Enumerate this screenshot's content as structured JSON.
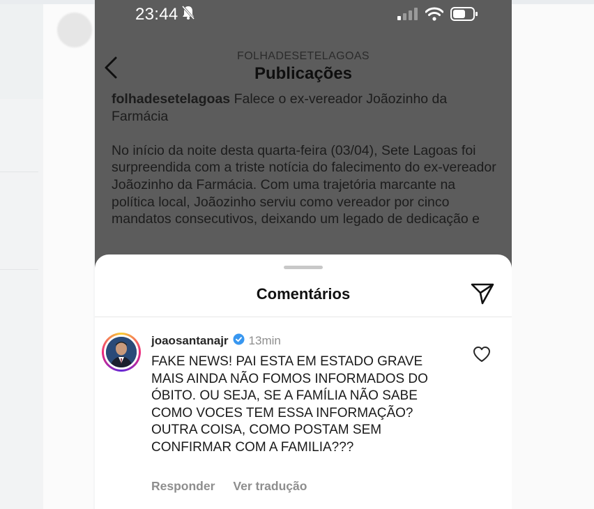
{
  "status_bar": {
    "time": "23:44"
  },
  "header": {
    "account": "FOLHADESETELAGOAS",
    "title": "Publicações"
  },
  "caption": {
    "username": "folhadesetelagoas",
    "headline": "Falece o ex-vereador Joãozinho da Farmácia",
    "body": "No início da noite desta quarta-feira (03/04), Sete Lagoas foi surpreendida com a triste notícia do falecimento do ex-vereador Joãozinho da Farmácia. Com uma trajetória marcante na política local, Joãozinho serviu como vereador por cinco mandatos consecutivos, deixando um legado de dedicação e"
  },
  "comments_sheet": {
    "title": "Comentários",
    "comment": {
      "username": "joaosantanajr",
      "time": "13min",
      "text": "FAKE NEWS! PAI ESTA EM ESTADO GRAVE MAIS AINDA NÃO FOMOS INFORMADOS DO ÓBITO. OU SEJA, SE A FAMÍLIA NÃO SABE COMO VOCES TEM ESSA INFORMAÇÃO? OUTRA COISA, COMO POSTAM SEM CONFIRMAR COM A FAMILIA???",
      "reply_label": "Responder",
      "translate_label": "Ver tradução"
    }
  },
  "colors": {
    "verified": "#3897f0",
    "overlay": "#5c5c5c",
    "meta_text": "#8e8e8e"
  },
  "icons": [
    "back-chevron-icon",
    "silent-bell-icon",
    "signal-icon",
    "wifi-icon",
    "battery-icon",
    "send-icon",
    "verified-badge-icon",
    "heart-icon"
  ]
}
